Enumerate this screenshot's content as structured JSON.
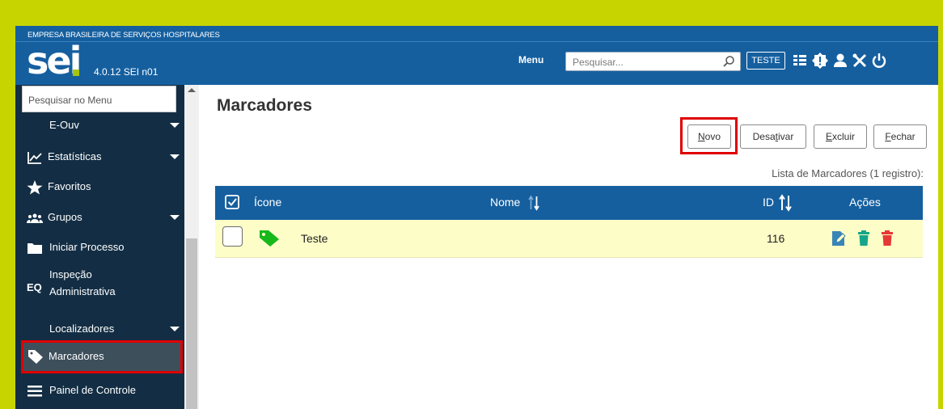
{
  "header": {
    "org_name": "EMPRESA BRASILEIRA DE SERVIÇOS HOSPITALARES",
    "logo_text": "sei",
    "version": "4.0.12 SEI n01",
    "menu_label": "Menu",
    "search_placeholder": "Pesquisar...",
    "user_badge": "TESTE",
    "icons": [
      "search-icon",
      "grid-icon",
      "alert-icon",
      "user-icon",
      "tools-icon",
      "power-icon"
    ]
  },
  "sidebar": {
    "search_placeholder": "Pesquisar no Menu",
    "items": [
      {
        "label": "E-Ouv",
        "icon": "",
        "has_caret": true
      },
      {
        "label": "Estatísticas",
        "icon": "chart-icon",
        "has_caret": true
      },
      {
        "label": "Favoritos",
        "icon": "star-icon",
        "has_caret": false
      },
      {
        "label": "Grupos",
        "icon": "group-icon",
        "has_caret": true
      },
      {
        "label": "Iniciar Processo",
        "icon": "folder-icon",
        "has_caret": false
      },
      {
        "label": "Inspeção",
        "label2": "Administrativa",
        "icon": "inspection-icon",
        "has_caret": false
      },
      {
        "label": "Localizadores",
        "icon": "",
        "has_caret": true
      },
      {
        "label": "Marcadores",
        "icon": "tag-icon",
        "has_caret": false,
        "active": true
      },
      {
        "label": "Painel de Controle",
        "icon": "list-icon",
        "has_caret": false
      }
    ]
  },
  "main": {
    "title": "Marcadores",
    "buttons": {
      "novo": {
        "label": "Novo",
        "accesskey": "N",
        "rest": "ovo"
      },
      "desativar": {
        "label": "Desativar",
        "pre": "Desa",
        "accesskey": "t",
        "rest": "ivar"
      },
      "excluir": {
        "label": "Excluir",
        "accesskey": "E",
        "rest": "xcluir"
      },
      "fechar": {
        "label": "Fechar",
        "accesskey": "F",
        "rest": "echar"
      }
    },
    "list_caption": "Lista de Marcadores (1 registro):",
    "table": {
      "headers": {
        "icone": "Ícone",
        "nome": "Nome",
        "id": "ID",
        "acoes": "Ações"
      },
      "rows": [
        {
          "nome": "Teste",
          "id": "116",
          "tag_color": "#18b81b",
          "actions": [
            "edit-icon",
            "deactivate-icon",
            "delete-icon"
          ]
        }
      ]
    }
  },
  "colors": {
    "accent_bar": "#155f9f",
    "sidebar_bg": "#132e44",
    "highlight_border": "#e00000",
    "row_highlight": "#fdfdc8",
    "frame_outer": "#c8d400"
  }
}
